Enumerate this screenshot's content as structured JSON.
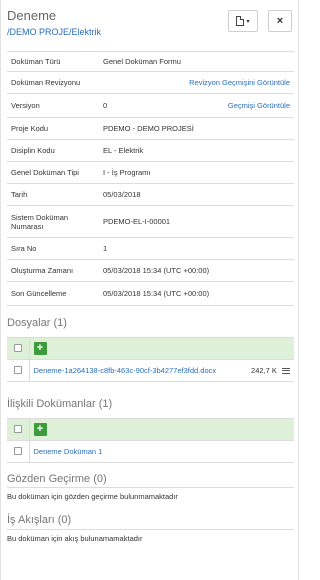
{
  "header": {
    "title": "Deneme",
    "path": "/DEMO PROJE/Elektrik",
    "close_label": "×",
    "caret": "▾"
  },
  "properties": [
    {
      "key": "Doküman Türü",
      "value": "Genel Doküman Formu"
    },
    {
      "key": "Doküman Revizyonu",
      "value": "",
      "link": "Revizyon Geçmişini Görüntüle"
    },
    {
      "key": "Versiyon",
      "value": "0",
      "link": "Geçmişi Görüntüle"
    },
    {
      "key": "Proje Kodu",
      "value": "PDEMO - DEMO PROJESİ"
    },
    {
      "key": "Disiplin Kodu",
      "value": "EL - Elektrik"
    },
    {
      "key": "Genel Doküman Tipi",
      "value": "I - İş Programı"
    },
    {
      "key": "Tarih",
      "value": "05/03/2018"
    },
    {
      "key": "Sistem Doküman Numarası",
      "value": "PDEMO-EL-I-00001"
    },
    {
      "key": "Sıra No",
      "value": "1"
    },
    {
      "key": "Oluşturma Zamanı",
      "value": "05/03/2018 15:34 (UTC +00:00)"
    },
    {
      "key": "Son Güncelleme",
      "value": "05/03/2018 15:34 (UTC +00:00)"
    }
  ],
  "files": {
    "title": "Dosyalar (1)",
    "add_label": "+",
    "items": [
      {
        "name": "Deneme-1a264138-c8fb-463c-90cf-3b4277ef3fdd.docx",
        "size": "242,7 K"
      }
    ]
  },
  "related": {
    "title": "İlişkili Dokümanlar (1)",
    "add_label": "+",
    "items": [
      {
        "name": "Deneme Doküman 1"
      }
    ]
  },
  "review": {
    "title": "Gözden Geçirme (0)",
    "note": "Bu doküman için gözden geçirme bulunmamaktadır"
  },
  "workflows": {
    "title": "İş Akışları (0)",
    "note": "Bu doküman için akış bulunamamaktadır"
  }
}
